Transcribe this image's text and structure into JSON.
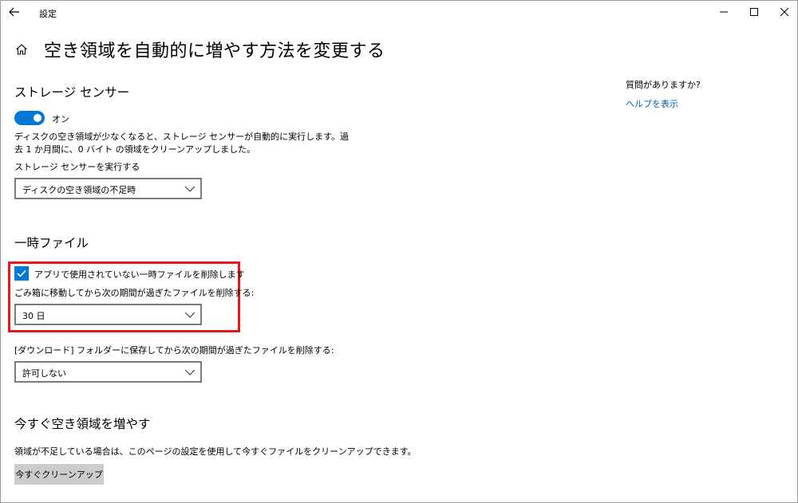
{
  "window": {
    "app_title": "設定",
    "icons": {
      "back": "back-arrow-icon",
      "minimize": "minimize-icon",
      "maximize": "maximize-icon",
      "close": "close-icon",
      "home": "home-icon",
      "chevron": "chevron-down-icon",
      "check": "checkmark-icon"
    }
  },
  "page": {
    "title": "空き領域を自動的に増やす方法を変更する"
  },
  "help": {
    "question": "質問がありますか?",
    "link": "ヘルプを表示"
  },
  "storage_sense": {
    "heading": "ストレージ センサー",
    "toggle_label": "オン",
    "toggle_on": true,
    "description_line1": "ディスクの空き領域が少なくなると、ストレージ センサーが自動的に実行します。過",
    "description_line2": "去 1 か月間に、0 バイト の領域をクリーンアップしました。",
    "run_label": "ストレージ センサーを実行する",
    "run_value": "ディスクの空き領域の不足時"
  },
  "temp_files": {
    "heading": "一時ファイル",
    "delete_unused_label": "アプリで使用されていない一時ファイルを削除します",
    "delete_unused_checked": true,
    "recycle_label": "ごみ箱に移動してから次の期間が過ぎたファイルを削除する:",
    "recycle_value": "30 日",
    "downloads_label": "[ダウンロード] フォルダーに保存してから次の期間が過ぎたファイルを削除する:",
    "downloads_value": "許可しない"
  },
  "free_now": {
    "heading": "今すぐ空き領域を増やす",
    "description": "領域が不足している場合は、このページの設定を使用して今すぐファイルをクリーンアップできます。",
    "button_label": "今すぐクリーンアップ"
  },
  "colors": {
    "accent": "#0078d7",
    "link": "#0063b1",
    "highlight": "#e8161b",
    "button_bg": "#cccccc"
  }
}
